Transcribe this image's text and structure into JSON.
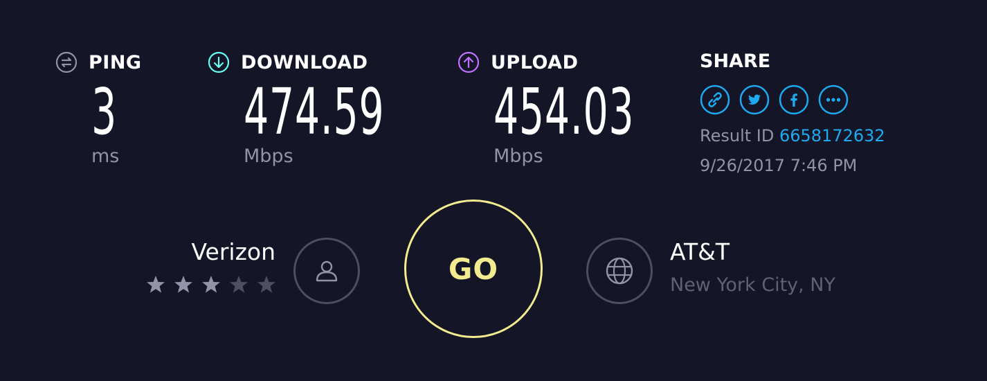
{
  "metrics": {
    "ping": {
      "label": "PING",
      "value": "3",
      "unit": "ms",
      "icon": "ping-icon"
    },
    "download": {
      "label": "DOWNLOAD",
      "value": "474.59",
      "unit": "Mbps",
      "icon": "download-arrow-icon",
      "color": "#6afff3"
    },
    "upload": {
      "label": "UPLOAD",
      "value": "454.03",
      "unit": "Mbps",
      "icon": "upload-arrow-icon",
      "color": "#bf71ff"
    }
  },
  "share": {
    "title": "SHARE",
    "icons": [
      "link-icon",
      "twitter-icon",
      "facebook-icon",
      "more-icon"
    ],
    "result_label": "Result ID",
    "result_id": "6658172632",
    "datetime": "9/26/2017 7:46 PM",
    "accent": "#1eaaf1"
  },
  "isp": {
    "name": "Verizon",
    "rating": 3,
    "rating_max": 5,
    "icon": "user-icon"
  },
  "go": {
    "label": "GO",
    "color": "#f3eb8f"
  },
  "server": {
    "name": "AT&T",
    "location": "New York City, NY",
    "icon": "globe-icon"
  }
}
